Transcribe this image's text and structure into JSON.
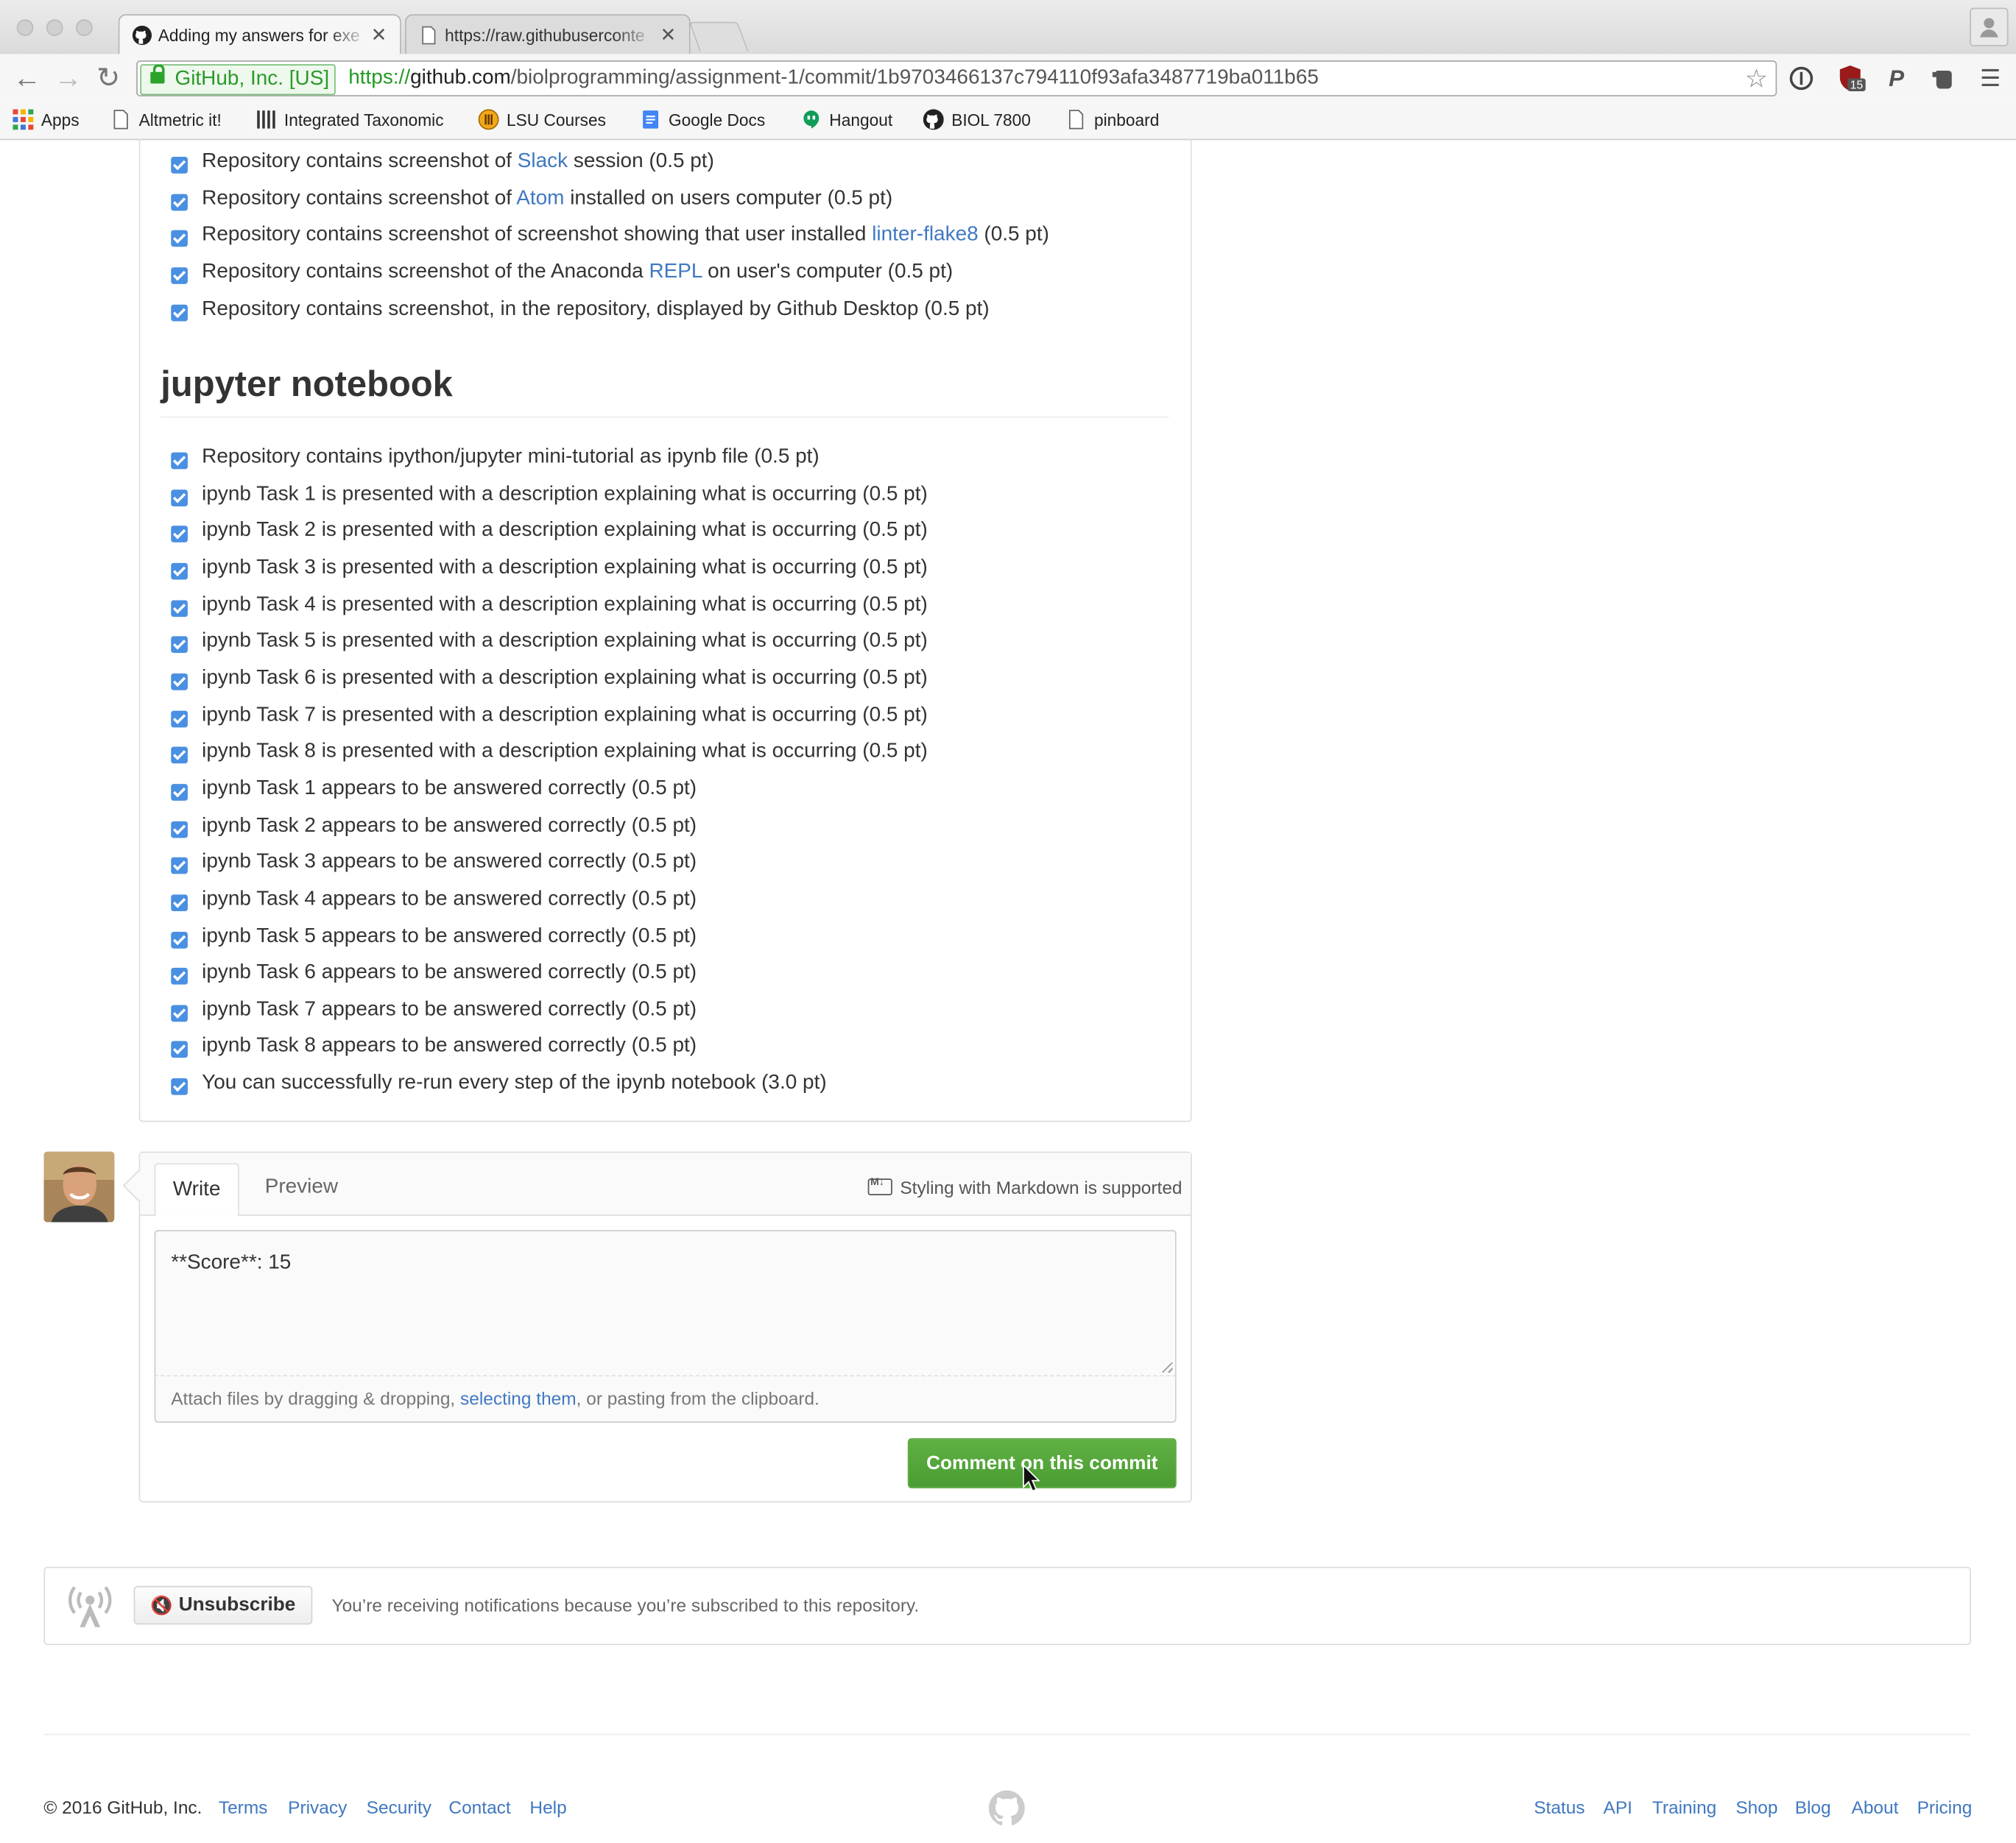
{
  "browser": {
    "tabs": [
      {
        "title": "Adding my answers for exe",
        "active": true,
        "icon": "github-icon"
      },
      {
        "title": "https://raw.githubuserconte",
        "active": false,
        "icon": "page-icon"
      }
    ],
    "ev_label": "GitHub, Inc. [US]",
    "url_scheme": "https://",
    "url_host": "github.com",
    "url_path": "/biolprogramming/assignment-1/commit/1b9703466137c794110f93afa3487719ba011b65",
    "extension_badge": "15",
    "bookmarks": [
      {
        "label": "Apps",
        "icon": "apps-grid-icon"
      },
      {
        "label": "Altmetric it!",
        "icon": "page-icon"
      },
      {
        "label": "Integrated Taxonomic",
        "icon": "itis-icon"
      },
      {
        "label": "LSU Courses",
        "icon": "lsu-icon"
      },
      {
        "label": "Google Docs",
        "icon": "docs-icon"
      },
      {
        "label": "Hangout",
        "icon": "hangout-icon"
      },
      {
        "label": "BIOL 7800",
        "icon": "github-icon"
      },
      {
        "label": "pinboard",
        "icon": "page-icon"
      }
    ]
  },
  "checklist_top": [
    {
      "pre": "Repository contains screenshot of ",
      "link": "Slack",
      "post": " session (0.5 pt)"
    },
    {
      "pre": "Repository contains screenshot of ",
      "link": "Atom",
      "post": " installed on users computer (0.5 pt)"
    },
    {
      "pre": "Repository contains screenshot of screenshot showing that user installed ",
      "link": "linter-flake8",
      "post": " (0.5 pt)"
    },
    {
      "pre": "Repository contains screenshot of the Anaconda ",
      "link": "REPL",
      "post": " on user's computer (0.5 pt)"
    },
    {
      "pre": "Repository contains screenshot, in the repository, displayed by Github Desktop (0.5 pt)",
      "link": "",
      "post": ""
    }
  ],
  "section_heading": "jupyter notebook",
  "checklist_jupyter": [
    "Repository contains ipython/jupyter mini-tutorial as ipynb file (0.5 pt)",
    "ipynb Task 1 is presented with a description explaining what is occurring (0.5 pt)",
    "ipynb Task 2 is presented with a description explaining what is occurring (0.5 pt)",
    "ipynb Task 3 is presented with a description explaining what is occurring (0.5 pt)",
    "ipynb Task 4 is presented with a description explaining what is occurring (0.5 pt)",
    "ipynb Task 5 is presented with a description explaining what is occurring (0.5 pt)",
    "ipynb Task 6 is presented with a description explaining what is occurring (0.5 pt)",
    "ipynb Task 7 is presented with a description explaining what is occurring (0.5 pt)",
    "ipynb Task 8 is presented with a description explaining what is occurring (0.5 pt)",
    "ipynb Task 1 appears to be answered correctly (0.5 pt)",
    "ipynb Task 2 appears to be answered correctly (0.5 pt)",
    "ipynb Task 3 appears to be answered correctly (0.5 pt)",
    "ipynb Task 4 appears to be answered correctly (0.5 pt)",
    "ipynb Task 5 appears to be answered correctly (0.5 pt)",
    "ipynb Task 6 appears to be answered correctly (0.5 pt)",
    "ipynb Task 7 appears to be answered correctly (0.5 pt)",
    "ipynb Task 8 appears to be answered correctly (0.5 pt)",
    "You can successfully re-run every step of the ipynb notebook (3.0 pt)"
  ],
  "comment_form": {
    "tab_write": "Write",
    "tab_preview": "Preview",
    "markdown_note": "Styling with Markdown is supported",
    "textarea_value": "**Score**: 15",
    "attach_pre": "Attach files by dragging & dropping, ",
    "attach_link": "selecting them",
    "attach_post": ", or pasting from the clipboard.",
    "submit_label": "Comment on this commit"
  },
  "subscription": {
    "button_label": "Unsubscribe",
    "note": "You’re receiving notifications because you’re subscribed to this repository."
  },
  "footer": {
    "copyright": "© 2016 GitHub, Inc.",
    "left_links": [
      "Terms",
      "Privacy",
      "Security",
      "Contact",
      "Help"
    ],
    "right_links": [
      "Status",
      "API",
      "Training",
      "Shop",
      "Blog",
      "About",
      "Pricing"
    ]
  },
  "colors": {
    "link": "#4078c0",
    "checkbox": "#4a90e2",
    "primary_button": "#55a532",
    "secure_green": "#2a9a2a"
  }
}
